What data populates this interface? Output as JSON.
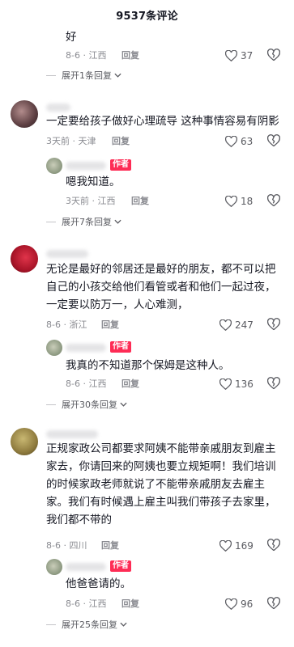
{
  "header": {
    "title": "9537条评论"
  },
  "colors": {
    "author_badge": "#fe2c55",
    "meta": "#8a8b91",
    "text": "#161823"
  },
  "comments": [
    {
      "text": "好",
      "time": "8-6",
      "location": "江西",
      "reply_label": "回复",
      "likes": "37",
      "expand": "展开1条回复"
    },
    {
      "text": "一定要给孩子做好心理疏导 这种事情容易有阴影",
      "time": "3天前",
      "location": "天津",
      "reply_label": "回复",
      "likes": "63",
      "reply": {
        "badge": "作者",
        "text": "嗯我知道。",
        "time": "3天前",
        "location": "江西",
        "reply_label": "回复",
        "likes": "18"
      },
      "expand": "展开7条回复"
    },
    {
      "text_lines": [
        "无论是最好的邻居还是最好的朋友，都不可以把",
        "自己的小孩交给他们看管或者和他们一起过夜，",
        "一定要以防万一，人心难测，"
      ],
      "time": "8-6",
      "location": "浙江",
      "reply_label": "回复",
      "likes": "247",
      "reply": {
        "badge": "作者",
        "text": "我真的不知道那个保姆是这种人。",
        "time": "8-6",
        "location": "江西",
        "reply_label": "回复",
        "likes": "136"
      },
      "expand": "展开30条回复"
    },
    {
      "text_lines": [
        "正规家政公司都要求阿姨不能带亲戚朋友到雇主",
        "家去，你请回来的阿姨也要立规矩啊！我们培训",
        "的时候家政老师就说了不能带亲戚朋友去雇主",
        "家。我们有时候遇上雇主叫我们带孩子去家里，",
        "我们都不带的"
      ],
      "time": "8-6",
      "location": "四川",
      "reply_label": "回复",
      "likes": "169",
      "reply": {
        "badge": "作者",
        "text": "他爸爸请的。",
        "time": "8-6",
        "location": "江西",
        "reply_label": "回复",
        "likes": "96"
      },
      "expand": "展开25条回复"
    }
  ]
}
